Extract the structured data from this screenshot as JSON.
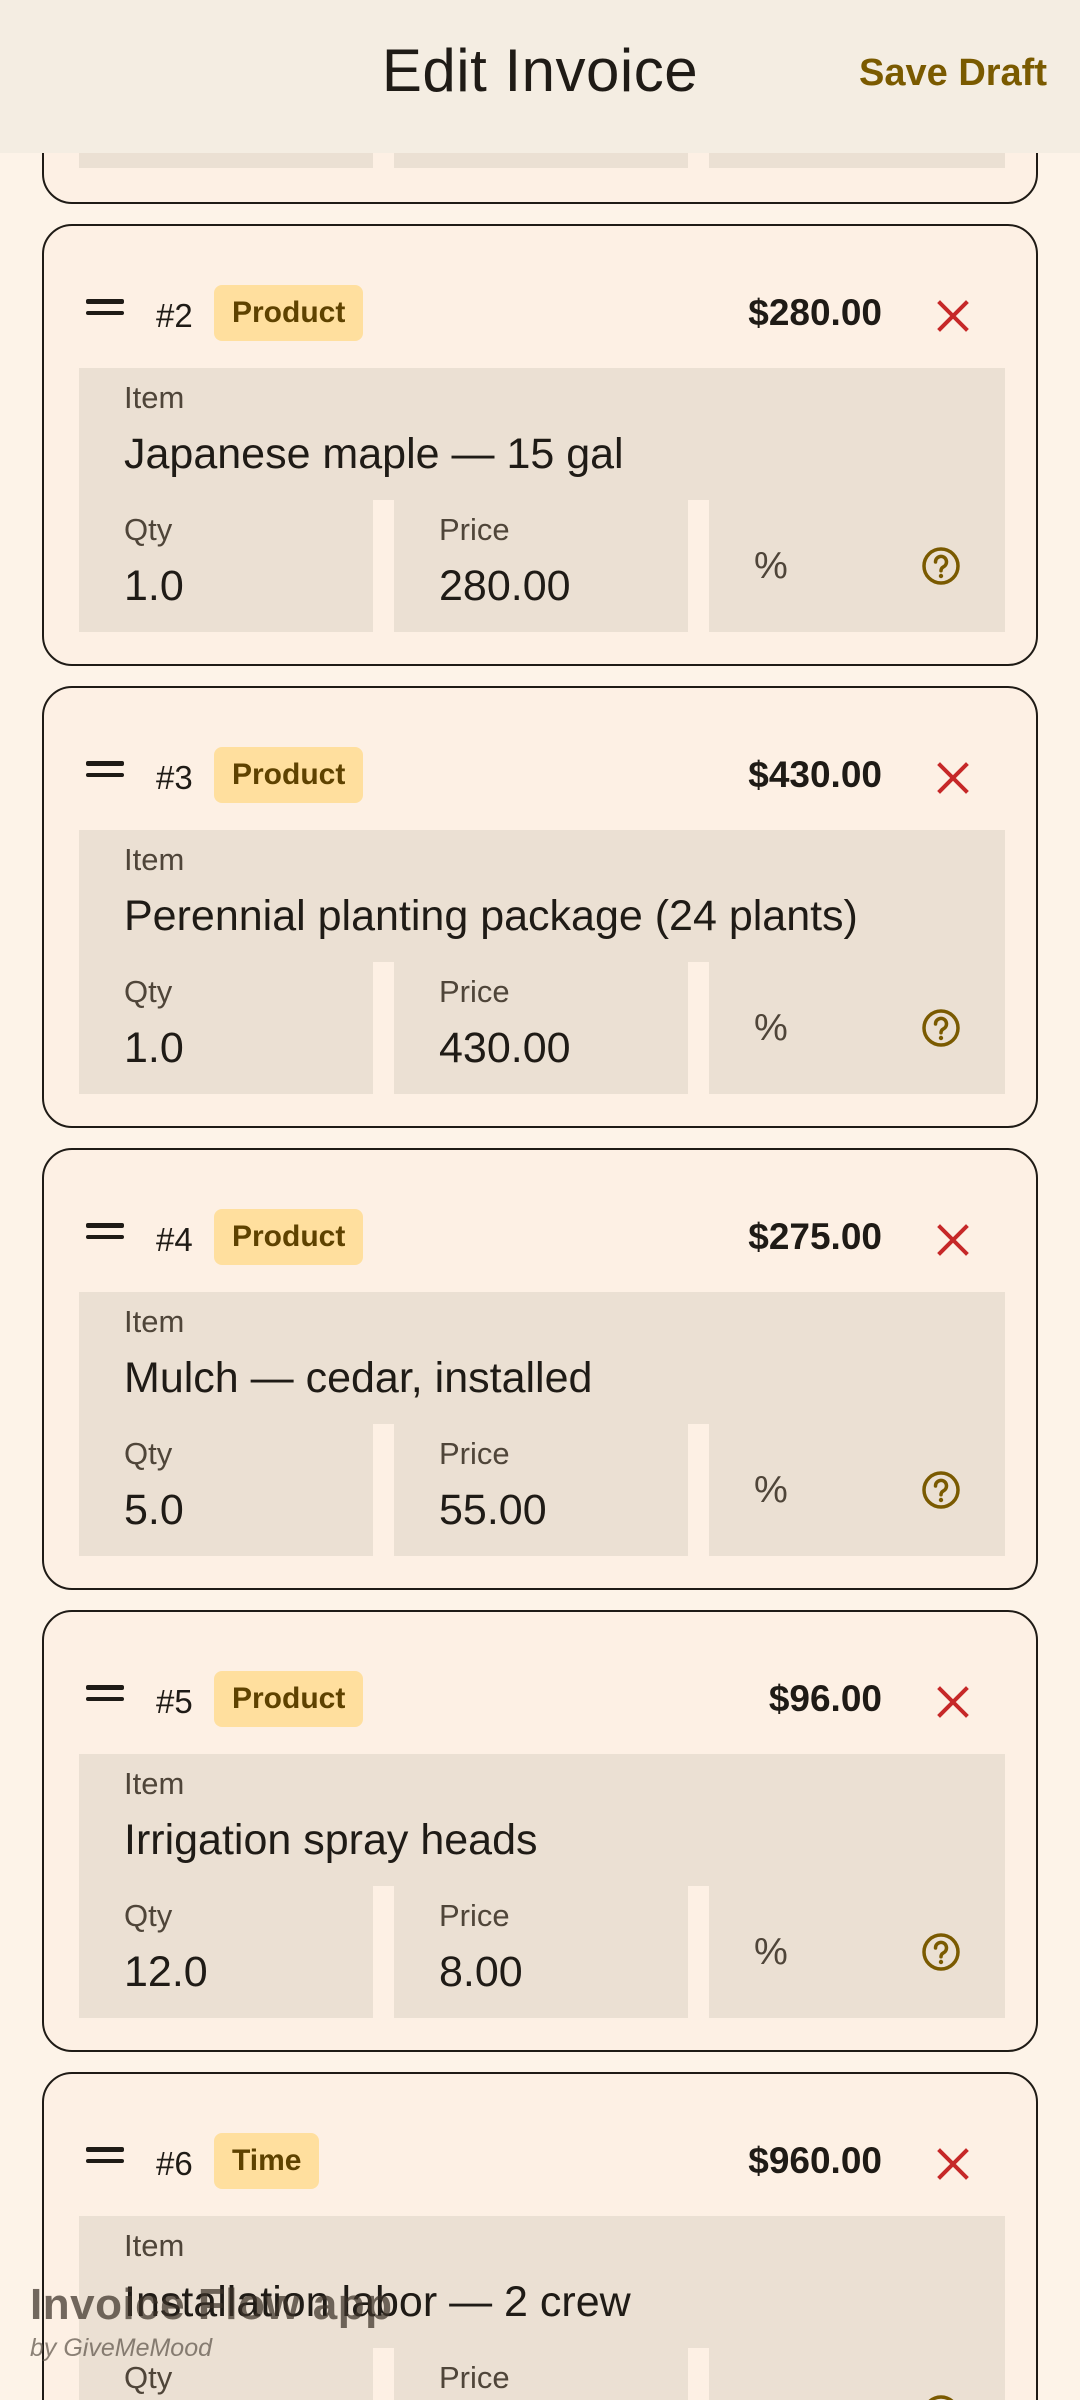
{
  "app_bar": {
    "title": "Edit Invoice",
    "save_label": "Save Draft"
  },
  "labels": {
    "item": "Item",
    "qty": "Qty",
    "price": "Price",
    "percent": "%"
  },
  "line_items": [
    {
      "number": "#2",
      "type": "Product",
      "total": "$280.00",
      "item": "Japanese maple — 15 gal",
      "qty": "1.0",
      "price": "280.00"
    },
    {
      "number": "#3",
      "type": "Product",
      "total": "$430.00",
      "item": "Perennial planting package (24 plants)",
      "qty": "1.0",
      "price": "430.00"
    },
    {
      "number": "#4",
      "type": "Product",
      "total": "$275.00",
      "item": "Mulch — cedar, installed",
      "qty": "5.0",
      "price": "55.00"
    },
    {
      "number": "#5",
      "type": "Product",
      "total": "$96.00",
      "item": "Irrigation spray heads",
      "qty": "12.0",
      "price": "8.00"
    },
    {
      "number": "#6",
      "type": "Time",
      "total": "$960.00",
      "item": "Installation labor — 2 crew",
      "qty": "",
      "price": ""
    }
  ],
  "watermark": {
    "title": "Invoice Flow app",
    "subtitle": "by GiveMeMood"
  },
  "icons": {
    "drag": "drag-handle-icon",
    "remove": "close-icon",
    "help": "help-circle-icon"
  },
  "colors": {
    "background": "#fdf3e8",
    "app_bar": "#f4ede2",
    "accent": "#7a5a00",
    "chip": "#ffdf9e",
    "remove": "#c62828",
    "field": "#ebe0d3"
  }
}
